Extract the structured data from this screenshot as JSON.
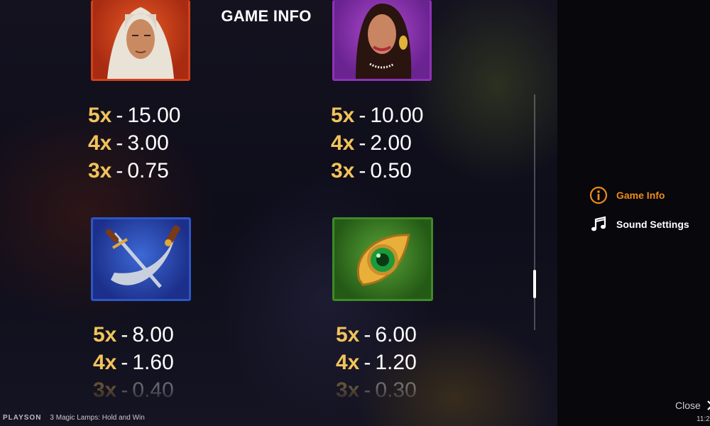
{
  "header": {
    "title": "GAME INFO"
  },
  "paytables": [
    {
      "symbol": "turbaned-man-symbol",
      "rows": [
        {
          "mult": "5x",
          "amount": "15.00"
        },
        {
          "mult": "4x",
          "amount": "3.00"
        },
        {
          "mult": "3x",
          "amount": "0.75"
        }
      ]
    },
    {
      "symbol": "princess-symbol",
      "rows": [
        {
          "mult": "5x",
          "amount": "10.00"
        },
        {
          "mult": "4x",
          "amount": "2.00"
        },
        {
          "mult": "3x",
          "amount": "0.50"
        }
      ]
    },
    {
      "symbol": "crossed-swords-symbol",
      "rows": [
        {
          "mult": "5x",
          "amount": "8.00"
        },
        {
          "mult": "4x",
          "amount": "1.60"
        },
        {
          "mult": "3x",
          "amount": "0.40"
        }
      ]
    },
    {
      "symbol": "green-gem-symbol",
      "rows": [
        {
          "mult": "5x",
          "amount": "6.00"
        },
        {
          "mult": "4x",
          "amount": "1.20"
        },
        {
          "mult": "3x",
          "amount": "0.30"
        }
      ]
    }
  ],
  "dash": "-",
  "menu": {
    "game_info": "Game Info",
    "sound_settings": "Sound Settings",
    "close": "Close"
  },
  "footer": {
    "brand": "PLAYSON",
    "game_name": "3 Magic Lamps: Hold and Win",
    "clock": "11:2"
  },
  "colors": {
    "accent": "#f08a1c",
    "multiplier": "#f2c35a",
    "panel": "#07070c"
  }
}
